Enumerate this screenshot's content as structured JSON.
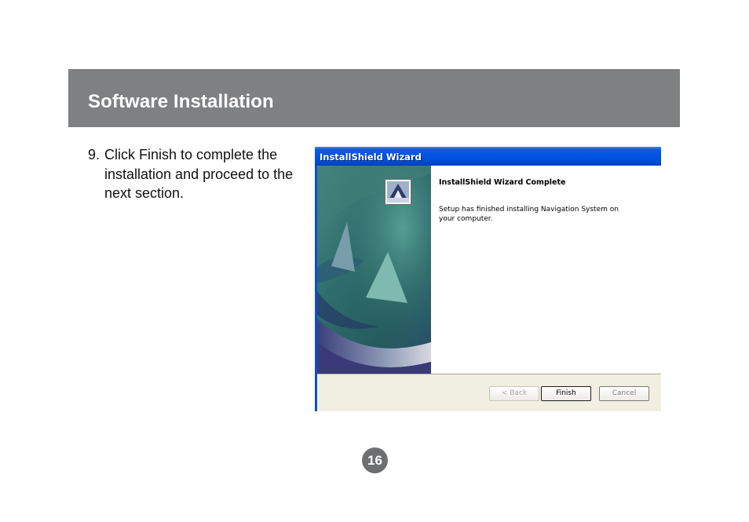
{
  "header": {
    "title": "Software Installation"
  },
  "step": {
    "number": "9.",
    "text": "Click Finish to complete the installation and proceed to the next section."
  },
  "wizard": {
    "title": "InstallShield Wizard",
    "icon": "installshield-wizard-icon",
    "heading": "InstallShield Wizard Complete",
    "message": "Setup has finished installing Navigation System on your computer.",
    "buttons": {
      "back": "< Back",
      "finish": "Finish",
      "cancel": "Cancel"
    },
    "colors": {
      "titlebar": "#0054e3",
      "button_face": "#f1efe2"
    }
  },
  "page_number": "16",
  "colors": {
    "header_band": "#7f8081",
    "page_badge": "#6e6f71"
  }
}
